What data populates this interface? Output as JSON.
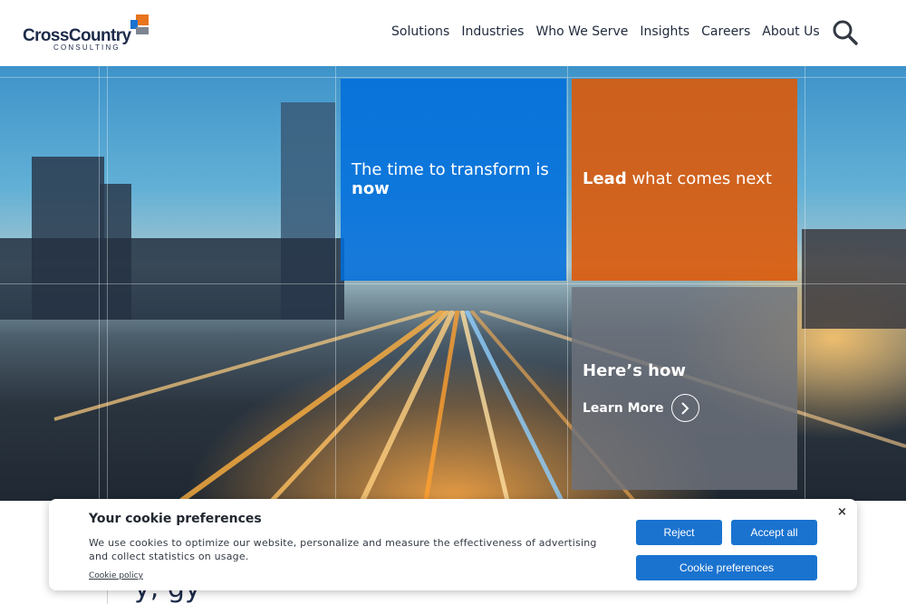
{
  "header": {
    "logo": {
      "name": "CrossCountry",
      "subtitle": "CONSULTING"
    },
    "nav": [
      {
        "label": "Solutions"
      },
      {
        "label": "Industries"
      },
      {
        "label": "Who We Serve"
      },
      {
        "label": "Insights"
      },
      {
        "label": "Careers"
      },
      {
        "label": "About Us"
      }
    ],
    "search_icon": "search-icon"
  },
  "hero": {
    "tile_blue": {
      "text_regular": "The time to transform is",
      "text_bold": "now",
      "color": "#0a6fdc"
    },
    "tile_orange": {
      "text_bold": "Lead",
      "text_regular": "what comes next",
      "color": "#dc5a0a"
    },
    "tile_gray": {
      "heading": "Here’s how",
      "cta_label": "Learn More",
      "cta_icon": "chevron-right-icon"
    }
  },
  "below": {
    "partial_heading": "y,         gy"
  },
  "cookie": {
    "title": "Your cookie preferences",
    "description": "We use cookies to optimize our website, personalize and measure the effectiveness of advertising and collect statistics on usage.",
    "policy_link": "Cookie policy",
    "reject_label": "Reject",
    "accept_label": "Accept all",
    "preferences_label": "Cookie preferences",
    "close_label": "×",
    "button_color": "#1a73cf"
  }
}
